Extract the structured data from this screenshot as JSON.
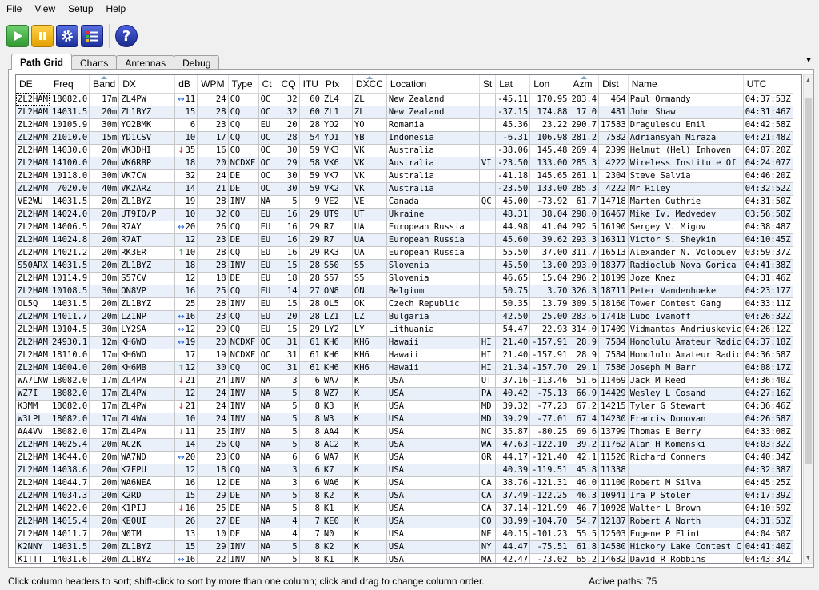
{
  "menu": [
    "File",
    "View",
    "Setup",
    "Help"
  ],
  "toolbar": {
    "play": "play-icon",
    "pause": "pause-icon",
    "settings": "gear-icon",
    "list": "list-icon",
    "help": "help-icon",
    "help_glyph": "?"
  },
  "tabs": [
    "Path Grid",
    "Charts",
    "Antennas",
    "Debug"
  ],
  "active_tab": "Path Grid",
  "columns": [
    "DE",
    "Freq",
    "Band",
    "DX",
    "dB",
    "WPM",
    "Type",
    "Ct",
    "CQ",
    "ITU",
    "Pfx",
    "DXCC",
    "Location",
    "St",
    "Lat",
    "Lon",
    "Azm",
    "Dist",
    "Name",
    "UTC"
  ],
  "sorted_columns": [
    "Band",
    "DXCC",
    "Azm"
  ],
  "rows": [
    [
      "ZL2HAM",
      "18082.0",
      "17m",
      "ZL4PW",
      "lr",
      "11",
      "24",
      "CQ",
      "OC",
      "32",
      "60",
      "ZL4",
      "ZL",
      "New Zealand",
      "",
      "-45.11",
      "170.95",
      "203.4",
      "464",
      "Paul Ormandy",
      "04:37:53Z"
    ],
    [
      "ZL2HAM",
      "14031.5",
      "20m",
      "ZL1BYZ",
      "",
      "15",
      "28",
      "CQ",
      "OC",
      "32",
      "60",
      "ZL1",
      "ZL",
      "New Zealand",
      "",
      "-37.15",
      "174.88",
      "17.0",
      "481",
      "John Shaw",
      "04:31:46Z"
    ],
    [
      "ZL2HAM",
      "10105.9",
      "30m",
      "YO2BMK",
      "",
      "6",
      "23",
      "CQ",
      "EU",
      "20",
      "28",
      "YO2",
      "YO",
      "Romania",
      "",
      "45.36",
      "23.22",
      "290.7",
      "17583",
      "Dragulescu Emil",
      "04:42:58Z"
    ],
    [
      "ZL2HAM",
      "21010.0",
      "15m",
      "YD1CSV",
      "",
      "10",
      "17",
      "CQ",
      "OC",
      "28",
      "54",
      "YD1",
      "YB",
      "Indonesia",
      "",
      "-6.31",
      "106.98",
      "281.2",
      "7582",
      "Adriansyah Miraza",
      "04:21:48Z"
    ],
    [
      "ZL2HAM",
      "14030.0",
      "20m",
      "VK3DHI",
      "down",
      "35",
      "16",
      "CQ",
      "OC",
      "30",
      "59",
      "VK3",
      "VK",
      "Australia",
      "",
      "-38.06",
      "145.48",
      "269.4",
      "2399",
      "Helmut (Hel) Inhoven",
      "04:07:20Z"
    ],
    [
      "ZL2HAM",
      "14100.0",
      "20m",
      "VK6RBP",
      "",
      "18",
      "20",
      "NCDXF",
      "OC",
      "29",
      "58",
      "VK6",
      "VK",
      "Australia",
      "VI",
      "-23.50",
      "133.00",
      "285.3",
      "4222",
      "Wireless Institute Of",
      "04:24:07Z"
    ],
    [
      "ZL2HAM",
      "10118.0",
      "30m",
      "VK7CW",
      "",
      "32",
      "24",
      "DE",
      "OC",
      "30",
      "59",
      "VK7",
      "VK",
      "Australia",
      "",
      "-41.18",
      "145.65",
      "261.1",
      "2304",
      "Steve Salvia",
      "04:46:20Z"
    ],
    [
      "ZL2HAM",
      "7020.0",
      "40m",
      "VK2ARZ",
      "",
      "14",
      "21",
      "DE",
      "OC",
      "30",
      "59",
      "VK2",
      "VK",
      "Australia",
      "",
      "-23.50",
      "133.00",
      "285.3",
      "4222",
      "Mr Riley",
      "04:32:52Z"
    ],
    [
      "VE2WU",
      "14031.5",
      "20m",
      "ZL1BYZ",
      "",
      "19",
      "28",
      "INV",
      "NA",
      "5",
      "9",
      "VE2",
      "VE",
      "Canada",
      "QC",
      "45.00",
      "-73.92",
      "61.7",
      "14718",
      "Marten Guthrie",
      "04:31:50Z"
    ],
    [
      "ZL2HAM",
      "14024.0",
      "20m",
      "UT9IO/P",
      "",
      "10",
      "32",
      "CQ",
      "EU",
      "16",
      "29",
      "UT9",
      "UT",
      "Ukraine",
      "",
      "48.31",
      "38.04",
      "298.0",
      "16467",
      "Mike Iv. Medvedev",
      "03:56:58Z"
    ],
    [
      "ZL2HAM",
      "14006.5",
      "20m",
      "R7AY",
      "lr",
      "20",
      "26",
      "CQ",
      "EU",
      "16",
      "29",
      "R7",
      "UA",
      "European Russia",
      "",
      "44.98",
      "41.04",
      "292.5",
      "16190",
      "Sergey V. Migov",
      "04:38:48Z"
    ],
    [
      "ZL2HAM",
      "14024.8",
      "20m",
      "R7AT",
      "",
      "12",
      "23",
      "DE",
      "EU",
      "16",
      "29",
      "R7",
      "UA",
      "European Russia",
      "",
      "45.60",
      "39.62",
      "293.3",
      "16311",
      "Victor S. Sheykin",
      "04:10:45Z"
    ],
    [
      "ZL2HAM",
      "14021.2",
      "20m",
      "RK3ER",
      "up",
      "10",
      "28",
      "CQ",
      "EU",
      "16",
      "29",
      "RK3",
      "UA",
      "European Russia",
      "",
      "55.50",
      "37.00",
      "311.7",
      "16513",
      "Alexander N. Volobuev",
      "03:59:37Z"
    ],
    [
      "S50ARX",
      "14031.5",
      "20m",
      "ZL1BYZ",
      "",
      "18",
      "28",
      "INV",
      "EU",
      "15",
      "28",
      "S50",
      "S5",
      "Slovenia",
      "",
      "45.50",
      "13.00",
      "293.0",
      "18377",
      "Radioclub Nova Gorica",
      "04:41:38Z"
    ],
    [
      "ZL2HAM",
      "10114.9",
      "30m",
      "S57CV",
      "",
      "12",
      "18",
      "DE",
      "EU",
      "18",
      "28",
      "S57",
      "S5",
      "Slovenia",
      "",
      "46.65",
      "15.04",
      "296.2",
      "18199",
      "Joze Knez",
      "04:31:46Z"
    ],
    [
      "ZL2HAM",
      "10108.5",
      "30m",
      "ON8VP",
      "",
      "16",
      "25",
      "CQ",
      "EU",
      "14",
      "27",
      "ON8",
      "ON",
      "Belgium",
      "",
      "50.75",
      "3.70",
      "326.3",
      "18711",
      "Peter Vandenhoeke",
      "04:23:17Z"
    ],
    [
      "OL5Q",
      "14031.5",
      "20m",
      "ZL1BYZ",
      "",
      "25",
      "28",
      "INV",
      "EU",
      "15",
      "28",
      "OL5",
      "OK",
      "Czech Republic",
      "",
      "50.35",
      "13.79",
      "309.5",
      "18160",
      "Tower Contest Gang",
      "04:33:11Z"
    ],
    [
      "ZL2HAM",
      "14011.7",
      "20m",
      "LZ1NP",
      "lr",
      "16",
      "23",
      "CQ",
      "EU",
      "20",
      "28",
      "LZ1",
      "LZ",
      "Bulgaria",
      "",
      "42.50",
      "25.00",
      "283.6",
      "17418",
      "Lubo Ivanoff",
      "04:26:32Z"
    ],
    [
      "ZL2HAM",
      "10104.5",
      "30m",
      "LY2SA",
      "lr",
      "12",
      "29",
      "CQ",
      "EU",
      "15",
      "29",
      "LY2",
      "LY",
      "Lithuania",
      "",
      "54.47",
      "22.93",
      "314.0",
      "17409",
      "Vidmantas Andriuskevic",
      "04:26:12Z"
    ],
    [
      "ZL2HAM",
      "24930.1",
      "12m",
      "KH6WO",
      "lr",
      "19",
      "20",
      "NCDXF",
      "OC",
      "31",
      "61",
      "KH6",
      "KH6",
      "Hawaii",
      "HI",
      "21.40",
      "-157.91",
      "28.9",
      "7584",
      "Honolulu Amateur Radic",
      "04:37:18Z"
    ],
    [
      "ZL2HAM",
      "18110.0",
      "17m",
      "KH6WO",
      "",
      "17",
      "19",
      "NCDXF",
      "OC",
      "31",
      "61",
      "KH6",
      "KH6",
      "Hawaii",
      "HI",
      "21.40",
      "-157.91",
      "28.9",
      "7584",
      "Honolulu Amateur Radic",
      "04:36:58Z"
    ],
    [
      "ZL2HAM",
      "14004.0",
      "20m",
      "KH6MB",
      "up",
      "12",
      "30",
      "CQ",
      "OC",
      "31",
      "61",
      "KH6",
      "KH6",
      "Hawaii",
      "HI",
      "21.34",
      "-157.70",
      "29.1",
      "7586",
      "Joseph M Barr",
      "04:08:17Z"
    ],
    [
      "WA7LNW",
      "18082.0",
      "17m",
      "ZL4PW",
      "down",
      "21",
      "24",
      "INV",
      "NA",
      "3",
      "6",
      "WA7",
      "K",
      "USA",
      "UT",
      "37.16",
      "-113.46",
      "51.6",
      "11469",
      "Jack M Reed",
      "04:36:40Z"
    ],
    [
      "WZ7I",
      "18082.0",
      "17m",
      "ZL4PW",
      "",
      "12",
      "24",
      "INV",
      "NA",
      "5",
      "8",
      "WZ7",
      "K",
      "USA",
      "PA",
      "40.42",
      "-75.13",
      "66.9",
      "14429",
      "Wesley L Cosand",
      "04:27:16Z"
    ],
    [
      "K3MM",
      "18082.0",
      "17m",
      "ZL4PW",
      "down",
      "21",
      "24",
      "INV",
      "NA",
      "5",
      "8",
      "K3",
      "K",
      "USA",
      "MD",
      "39.32",
      "-77.23",
      "67.2",
      "14215",
      "Tyler G Stewart",
      "04:36:46Z"
    ],
    [
      "W3LPL",
      "18082.0",
      "17m",
      "ZL4WW",
      "",
      "10",
      "24",
      "INV",
      "NA",
      "5",
      "8",
      "W3",
      "K",
      "USA",
      "MD",
      "39.29",
      "-77.01",
      "67.4",
      "14230",
      "Francis Donovan",
      "04:26:58Z"
    ],
    [
      "AA4VV",
      "18082.0",
      "17m",
      "ZL4PW",
      "down",
      "11",
      "25",
      "INV",
      "NA",
      "5",
      "8",
      "AA4",
      "K",
      "USA",
      "NC",
      "35.87",
      "-80.25",
      "69.6",
      "13799",
      "Thomas E Berry",
      "04:33:08Z"
    ],
    [
      "ZL2HAM",
      "14025.4",
      "20m",
      "AC2K",
      "",
      "14",
      "26",
      "CQ",
      "NA",
      "5",
      "8",
      "AC2",
      "K",
      "USA",
      "WA",
      "47.63",
      "-122.10",
      "39.2",
      "11762",
      "Alan H Komenski",
      "04:03:32Z"
    ],
    [
      "ZL2HAM",
      "14044.0",
      "20m",
      "WA7ND",
      "lr",
      "20",
      "23",
      "CQ",
      "NA",
      "6",
      "6",
      "WA7",
      "K",
      "USA",
      "OR",
      "44.17",
      "-121.40",
      "42.1",
      "11526",
      "Richard Conners",
      "04:40:34Z"
    ],
    [
      "ZL2HAM",
      "14038.6",
      "20m",
      "K7FPU",
      "",
      "12",
      "18",
      "CQ",
      "NA",
      "3",
      "6",
      "K7",
      "K",
      "USA",
      "",
      "40.39",
      "-119.51",
      "45.8",
      "11338",
      "",
      "04:32:38Z"
    ],
    [
      "ZL2HAM",
      "14044.7",
      "20m",
      "WA6NEA",
      "",
      "16",
      "12",
      "DE",
      "NA",
      "3",
      "6",
      "WA6",
      "K",
      "USA",
      "CA",
      "38.76",
      "-121.31",
      "46.0",
      "11100",
      "Robert M Silva",
      "04:45:25Z"
    ],
    [
      "ZL2HAM",
      "14034.3",
      "20m",
      "K2RD",
      "",
      "15",
      "29",
      "DE",
      "NA",
      "5",
      "8",
      "K2",
      "K",
      "USA",
      "CA",
      "37.49",
      "-122.25",
      "46.3",
      "10941",
      "Ira P Stoler",
      "04:17:39Z"
    ],
    [
      "ZL2HAM",
      "14022.0",
      "20m",
      "K1PIJ",
      "down",
      "16",
      "25",
      "DE",
      "NA",
      "5",
      "8",
      "K1",
      "K",
      "USA",
      "CA",
      "37.14",
      "-121.99",
      "46.7",
      "10928",
      "Walter L Brown",
      "04:10:59Z"
    ],
    [
      "ZL2HAM",
      "14015.4",
      "20m",
      "KE0UI",
      "",
      "26",
      "27",
      "DE",
      "NA",
      "4",
      "7",
      "KE0",
      "K",
      "USA",
      "CO",
      "38.99",
      "-104.70",
      "54.7",
      "12187",
      "Robert A North",
      "04:31:53Z"
    ],
    [
      "ZL2HAM",
      "14011.7",
      "20m",
      "N0TM",
      "",
      "13",
      "10",
      "DE",
      "NA",
      "4",
      "7",
      "N0",
      "K",
      "USA",
      "NE",
      "40.15",
      "-101.23",
      "55.5",
      "12503",
      "Eugene P Flint",
      "04:04:50Z"
    ],
    [
      "K2NNY",
      "14031.5",
      "20m",
      "ZL1BYZ",
      "",
      "15",
      "29",
      "INV",
      "NA",
      "5",
      "8",
      "K2",
      "K",
      "USA",
      "NY",
      "44.47",
      "-75.51",
      "61.8",
      "14580",
      "Hickory Lake Contest C",
      "04:41:40Z"
    ],
    [
      "K1TTT",
      "14031.6",
      "20m",
      "ZL1BYZ",
      "lr",
      "16",
      "22",
      "INV",
      "NA",
      "5",
      "8",
      "K1",
      "K",
      "USA",
      "MA",
      "42.47",
      "-73.02",
      "65.2",
      "14682",
      "David R Robbins",
      "04:43:34Z"
    ]
  ],
  "status": {
    "message": "Click column headers to sort; shift-click to sort by more than one column; click and drag to change column order.",
    "active_label": "Active paths:",
    "active_count": "75"
  },
  "colors": {
    "row_alt": "#e9f0fa",
    "arrow_down": "#e02020",
    "arrow_up": "#20b040",
    "arrow_lr": "#2060d0"
  }
}
